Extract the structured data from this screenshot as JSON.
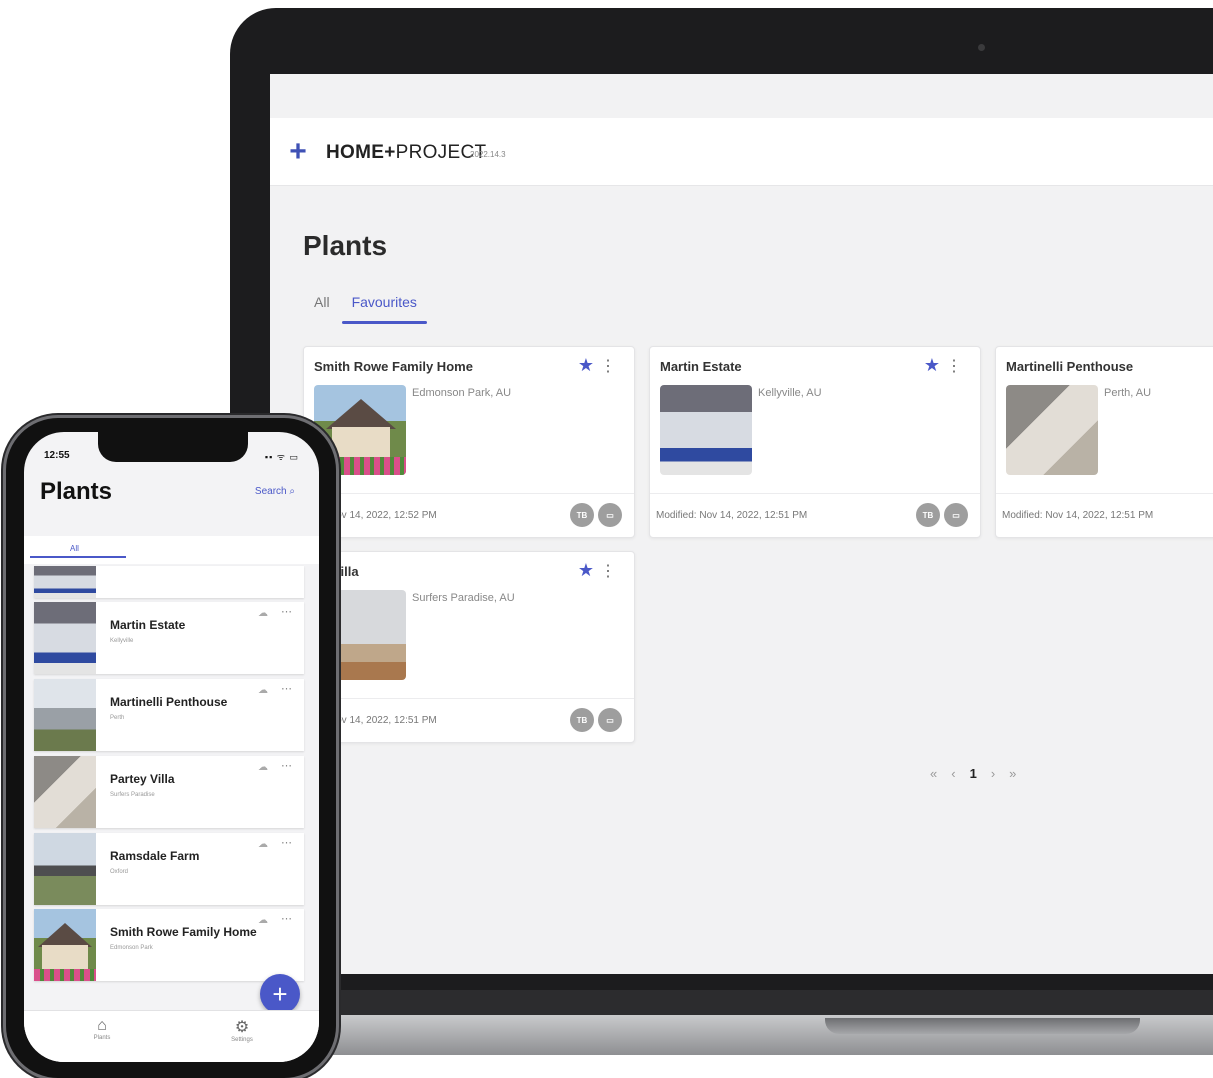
{
  "laptop": {
    "app": {
      "logo_symbol": "+",
      "brand_bold": "HOME+",
      "brand_rest": "PROJECT",
      "version": "2022.14.3"
    },
    "page_title": "Plants",
    "tabs": [
      {
        "label": "All",
        "active": false
      },
      {
        "label": "Favourites",
        "active": true
      }
    ],
    "cards": [
      {
        "title": "Smith Rowe Family Home",
        "location": "Edmonson Park, AU",
        "modified": "ied: Nov 14, 2022, 12:52 PM",
        "badge1": "TB",
        "favourite_icon": "star-icon"
      },
      {
        "title": "Martin Estate",
        "location": "Kellyville, AU",
        "modified": "Modified: Nov 14, 2022, 12:51 PM",
        "badge1": "TB",
        "favourite_icon": "star-icon"
      },
      {
        "title": "Martinelli Penthouse",
        "location": "Perth, AU",
        "modified": "Modified: Nov 14, 2022, 12:51 PM",
        "badge1": "TB",
        "favourite_icon": "star-icon"
      },
      {
        "title": "ey Villa",
        "location": "Surfers Paradise, AU",
        "modified": "ied: Nov 14, 2022, 12:51 PM",
        "badge1": "TB",
        "favourite_icon": "star-icon"
      }
    ],
    "pagination": {
      "first": "«",
      "prev": "‹",
      "current": "1",
      "next": "›",
      "last": "»"
    }
  },
  "phone": {
    "time": "12:55",
    "status": "▪▪ ᯤ ▭",
    "title": "Plants",
    "search_label": "Search",
    "search_icon": "⌕",
    "tab_all": "All",
    "items": [
      {
        "name": "Martin Estate",
        "sub": "Kellyville"
      },
      {
        "name": "Martinelli Penthouse",
        "sub": "Perth"
      },
      {
        "name": "Partey Villa",
        "sub": "Surfers Paradise"
      },
      {
        "name": "Ramsdale Farm",
        "sub": "Oxford"
      },
      {
        "name": "Smith Rowe Family Home",
        "sub": "Edmonson Park"
      }
    ],
    "fab": "+",
    "nav": [
      {
        "label": "Plants",
        "icon": "⌂"
      },
      {
        "label": "Settings",
        "icon": "⚙"
      }
    ]
  },
  "colors": {
    "accent": "#4a58c8",
    "badge": "#9e9e9e"
  }
}
